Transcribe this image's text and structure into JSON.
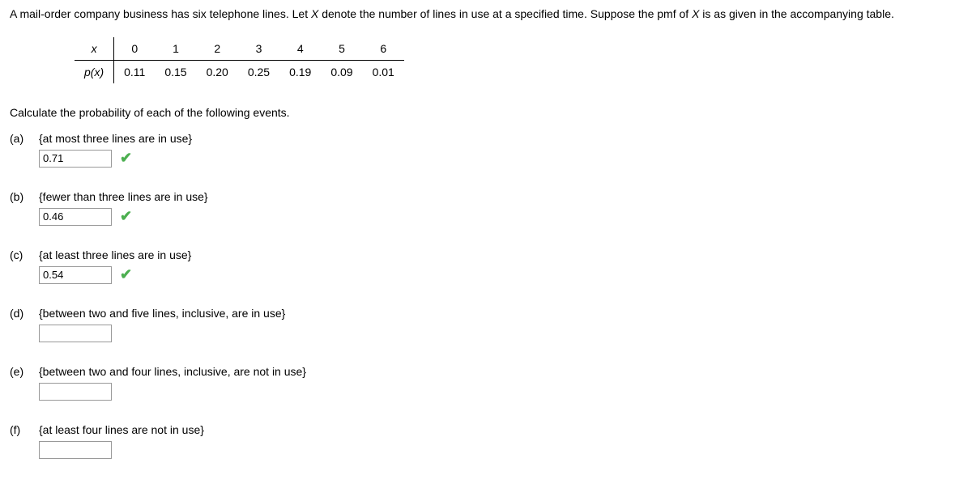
{
  "problem": {
    "intro_pre": "A mail-order company business has six telephone lines. Let ",
    "xvar": "X",
    "intro_mid": " denote the number of lines in use at a specified time. Suppose the pmf of ",
    "intro_post": " is as given in the accompanying table."
  },
  "pmf": {
    "row_x_label": "x",
    "row_p_label": "p(x)",
    "cols": [
      "0",
      "1",
      "2",
      "3",
      "4",
      "5",
      "6"
    ],
    "probs": [
      "0.11",
      "0.15",
      "0.20",
      "0.25",
      "0.19",
      "0.09",
      "0.01"
    ]
  },
  "instruction": "Calculate the probability of each of the following events.",
  "questions": {
    "a": {
      "label": "(a)",
      "text": "{at most three lines are in use}",
      "value": "0.71",
      "correct": true
    },
    "b": {
      "label": "(b)",
      "text": "{fewer than three lines are in use}",
      "value": "0.46",
      "correct": true
    },
    "c": {
      "label": "(c)",
      "text": "{at least three lines are in use}",
      "value": "0.54",
      "correct": true
    },
    "d": {
      "label": "(d)",
      "text": "{between two and five lines, inclusive, are in use}",
      "value": "",
      "correct": false
    },
    "e": {
      "label": "(e)",
      "text": "{between two and four lines, inclusive, are not in use}",
      "value": "",
      "correct": false
    },
    "f": {
      "label": "(f)",
      "text": "{at least four lines are not in use}",
      "value": "",
      "correct": false
    }
  }
}
